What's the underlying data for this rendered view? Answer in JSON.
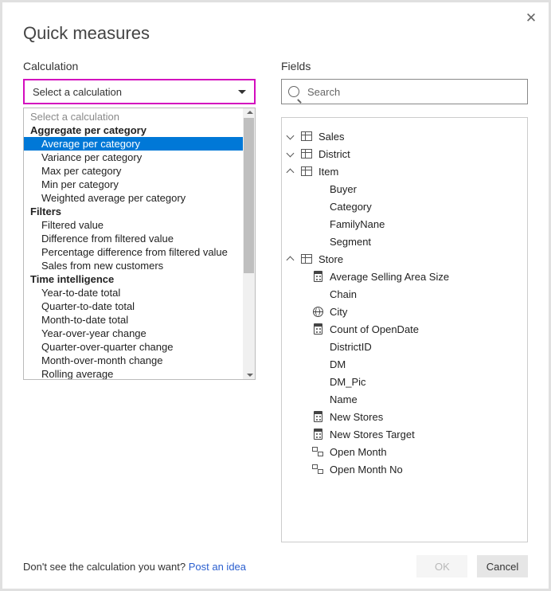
{
  "title": "Quick measures",
  "close_glyph": "✕",
  "calc": {
    "heading": "Calculation",
    "selected_label": "Select a calculation",
    "options": [
      {
        "kind": "hint",
        "label": "Select a calculation"
      },
      {
        "kind": "group",
        "label": "Aggregate per category"
      },
      {
        "kind": "item",
        "label": "Average per category",
        "selected": true
      },
      {
        "kind": "item",
        "label": "Variance per category"
      },
      {
        "kind": "item",
        "label": "Max per category"
      },
      {
        "kind": "item",
        "label": "Min per category"
      },
      {
        "kind": "item",
        "label": "Weighted average per category"
      },
      {
        "kind": "group",
        "label": "Filters"
      },
      {
        "kind": "item",
        "label": "Filtered value"
      },
      {
        "kind": "item",
        "label": "Difference from filtered value"
      },
      {
        "kind": "item",
        "label": "Percentage difference from filtered value"
      },
      {
        "kind": "item",
        "label": "Sales from new customers"
      },
      {
        "kind": "group",
        "label": "Time intelligence"
      },
      {
        "kind": "item",
        "label": "Year-to-date total"
      },
      {
        "kind": "item",
        "label": "Quarter-to-date total"
      },
      {
        "kind": "item",
        "label": "Month-to-date total"
      },
      {
        "kind": "item",
        "label": "Year-over-year change"
      },
      {
        "kind": "item",
        "label": "Quarter-over-quarter change"
      },
      {
        "kind": "item",
        "label": "Month-over-month change"
      },
      {
        "kind": "item",
        "label": "Rolling average"
      }
    ]
  },
  "fields": {
    "heading": "Fields",
    "search_placeholder": "Search",
    "tree": [
      {
        "lvl": 0,
        "chev": "down",
        "icon": "table",
        "label": "Sales"
      },
      {
        "lvl": 0,
        "chev": "down",
        "icon": "table",
        "label": "District"
      },
      {
        "lvl": 0,
        "chev": "up",
        "icon": "table",
        "label": "Item"
      },
      {
        "lvl": 1,
        "icon": "none",
        "label": "Buyer"
      },
      {
        "lvl": 1,
        "icon": "none",
        "label": "Category"
      },
      {
        "lvl": 1,
        "icon": "none",
        "label": "FamilyNane"
      },
      {
        "lvl": 1,
        "icon": "none",
        "label": "Segment"
      },
      {
        "lvl": 0,
        "chev": "up",
        "icon": "table",
        "label": "Store"
      },
      {
        "lvl": 1,
        "icon": "calc",
        "label": "Average Selling Area Size"
      },
      {
        "lvl": 1,
        "icon": "none",
        "label": "Chain"
      },
      {
        "lvl": 1,
        "icon": "globe",
        "label": "City"
      },
      {
        "lvl": 1,
        "icon": "calc",
        "label": "Count of OpenDate"
      },
      {
        "lvl": 1,
        "icon": "none",
        "label": "DistrictID"
      },
      {
        "lvl": 1,
        "icon": "none",
        "label": "DM"
      },
      {
        "lvl": 1,
        "icon": "none",
        "label": "DM_Pic"
      },
      {
        "lvl": 1,
        "icon": "none",
        "label": "Name"
      },
      {
        "lvl": 1,
        "icon": "calc",
        "label": "New Stores"
      },
      {
        "lvl": 1,
        "icon": "calc",
        "label": "New Stores Target"
      },
      {
        "lvl": 1,
        "icon": "hier",
        "label": "Open Month"
      },
      {
        "lvl": 1,
        "icon": "hier",
        "label": "Open Month No"
      }
    ]
  },
  "footer": {
    "prompt": "Don't see the calculation you want? ",
    "link": "Post an idea",
    "ok": "OK",
    "cancel": "Cancel"
  }
}
